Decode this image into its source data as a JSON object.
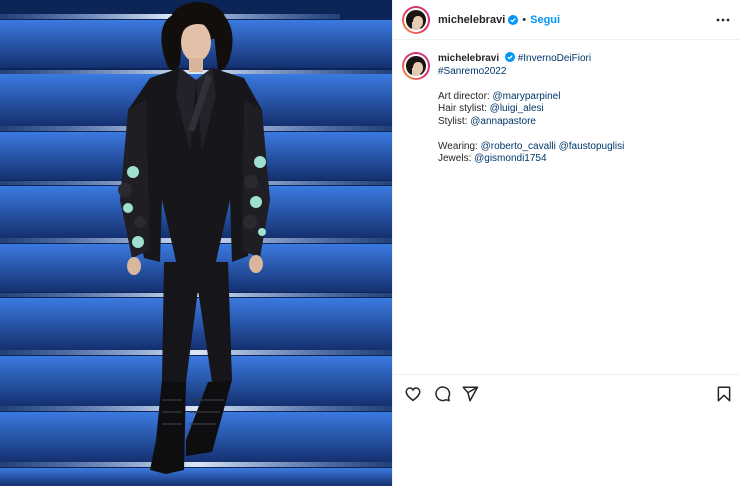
{
  "post": {
    "username": "michelebravi",
    "follow_label": "Segui",
    "separator": "•",
    "caption": {
      "username": "michelebravi",
      "hashtag_1": "#InvernoDeiFiori",
      "hashtag_2": "#Sanremo2022",
      "art_director_label": "Art director: ",
      "art_director_handle": "@maryparpinel",
      "hair_stylist_label": "Hair stylist: ",
      "hair_stylist_handle": "@luigi_alesi",
      "stylist_label": "Stylist: ",
      "stylist_handle": "@annapastore",
      "wearing_label": "Wearing: ",
      "wearing_handle_1": "@roberto_cavalli",
      "wearing_handle_2": "@faustopuglisi",
      "jewels_label": "Jewels: ",
      "jewels_handle": "@gismondi1754"
    }
  },
  "icons": {
    "verified": "verified-badge-icon",
    "more": "more-options-icon",
    "like": "heart-icon",
    "comment": "comment-icon",
    "share": "paper-plane-icon",
    "save": "bookmark-icon"
  },
  "colors": {
    "follow": "#0095f6",
    "verified": "#0095f6",
    "link": "#00376b",
    "text": "#262626",
    "divider": "#efefef"
  }
}
